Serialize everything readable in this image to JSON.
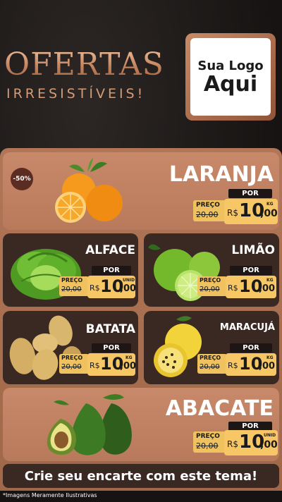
{
  "header": {
    "title": "OFERTAS",
    "subtitle": "IRRESISTÍVEIS!",
    "logo_line1": "Sua Logo",
    "logo_line2": "Aqui"
  },
  "discount_badge": "-50%",
  "price_labels": {
    "preco": "PREÇO",
    "por": "POR",
    "currency": "R$"
  },
  "products": [
    {
      "name": "LARANJA",
      "old_price": "20,00",
      "price_int": "10",
      "price_cents": ",00",
      "unit": "KG"
    },
    {
      "name": "ALFACE",
      "old_price": "20,00",
      "price_int": "10",
      "price_cents": ",00",
      "unit": "UNID"
    },
    {
      "name": "LIMÃO",
      "old_price": "20,00",
      "price_int": "10",
      "price_cents": ",00",
      "unit": "KG"
    },
    {
      "name": "BATATA",
      "old_price": "20,00",
      "price_int": "10",
      "price_cents": ",00",
      "unit": "KG"
    },
    {
      "name": "MARACUJÁ",
      "old_price": "20,00",
      "price_int": "10",
      "price_cents": ",00",
      "unit": "KG"
    },
    {
      "name": "ABACATE",
      "old_price": "20,00",
      "price_int": "10",
      "price_cents": ",00",
      "unit": "UNID"
    }
  ],
  "cta": "Crie seu encarte com este tema!",
  "footnote": "*Imagens Meramente Ilustrativas",
  "colors": {
    "gold": "#f0c25f",
    "panel": "#b07657",
    "dark_card": "#3a2822",
    "copper": "#c4845d"
  }
}
